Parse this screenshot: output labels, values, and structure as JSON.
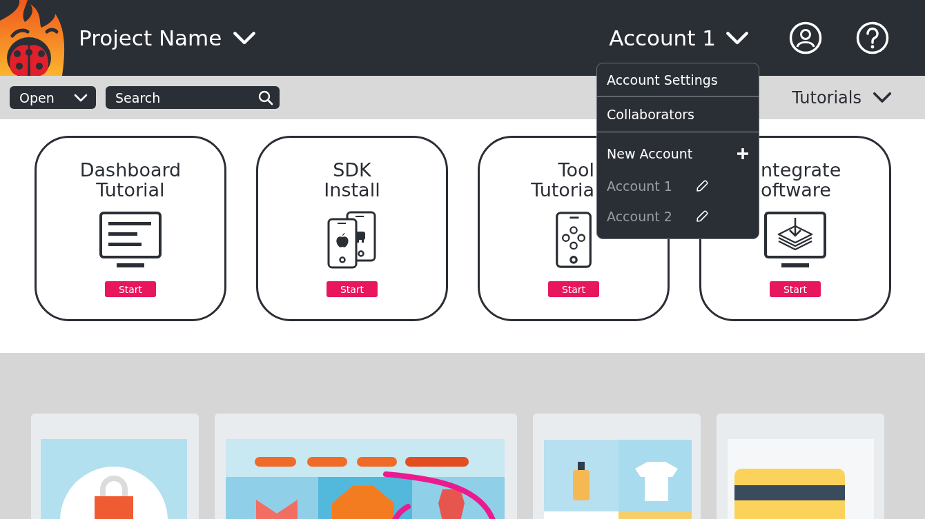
{
  "header": {
    "project": "Project Name",
    "account": "Account 1"
  },
  "toolbar": {
    "open": "Open",
    "search_placeholder": "Search",
    "tutorials": "Tutorials"
  },
  "account_menu": {
    "items": [
      {
        "label": "Account Settings",
        "kind": "link"
      },
      {
        "label": "Collaborators",
        "kind": "link"
      },
      {
        "label": "New Account",
        "kind": "add"
      },
      {
        "label": "Account 1",
        "kind": "account"
      },
      {
        "label": "Account 2",
        "kind": "account"
      }
    ]
  },
  "tutorial_cards": [
    {
      "title_lines": [
        "Dashboard",
        "Tutorial"
      ],
      "action": "Start"
    },
    {
      "title_lines": [
        "SDK",
        "Install"
      ],
      "action": "Start"
    },
    {
      "title_lines": [
        "Tool",
        "Tutoria"
      ],
      "action": "Start"
    },
    {
      "title_lines": [
        "ntegrate",
        "oftware"
      ],
      "action": "Start"
    }
  ]
}
